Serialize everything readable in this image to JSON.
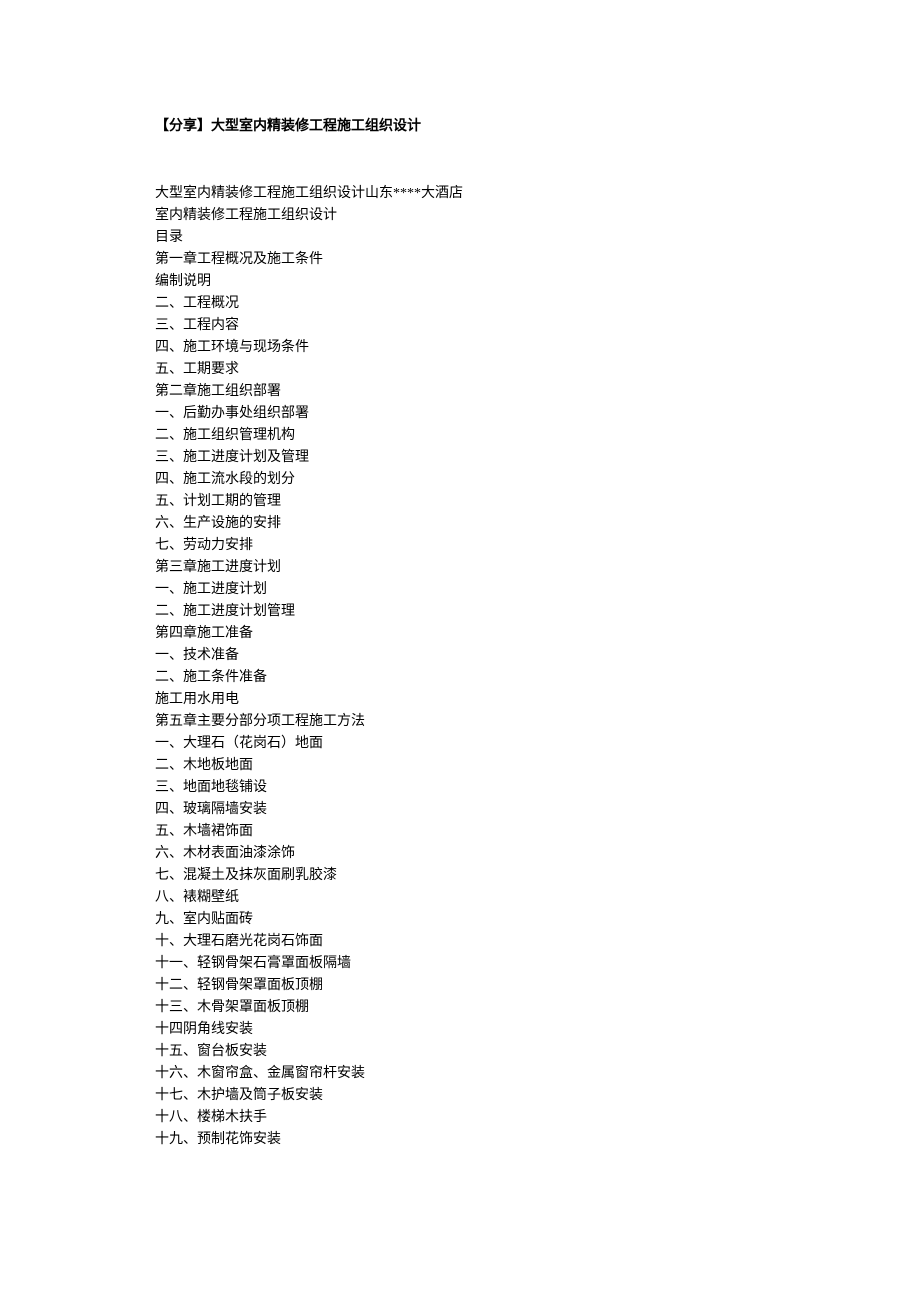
{
  "title": "【分享】大型室内精装修工程施工组织设计",
  "lines": [
    "大型室内精装修工程施工组织设计山东****大酒店",
    "室内精装修工程施工组织设计",
    "目录",
    "第一章工程概况及施工条件",
    "编制说明",
    "二、工程概况",
    "三、工程内容",
    "四、施工环境与现场条件",
    "五、工期要求",
    "第二章施工组织部署",
    "一、后勤办事处组织部署",
    "二、施工组织管理机构",
    "三、施工进度计划及管理",
    "四、施工流水段的划分",
    "五、计划工期的管理",
    "六、生产设施的安排",
    "七、劳动力安排",
    "第三章施工进度计划",
    "一、施工进度计划",
    "二、施工进度计划管理",
    "第四章施工准备",
    "一、技术准备",
    "二、施工条件准备",
    "施工用水用电",
    "第五章主要分部分项工程施工方法",
    "一、大理石（花岗石）地面",
    "二、木地板地面",
    "三、地面地毯铺设",
    "四、玻璃隔墙安装",
    "五、木墙裙饰面",
    "六、木材表面油漆涂饰",
    "七、混凝土及抹灰面刷乳胶漆",
    "八、裱糊壁纸",
    "九、室内贴面砖",
    "十、大理石磨光花岗石饰面",
    "十一、轻钢骨架石膏罩面板隔墙",
    "十二、轻钢骨架罩面板顶棚",
    "十三、木骨架罩面板顶棚",
    "十四阴角线安装",
    "十五、窗台板安装",
    "十六、木窗帘盒、金属窗帘杆安装",
    "十七、木护墙及筒子板安装",
    "十八、楼梯木扶手",
    "十九、预制花饰安装"
  ]
}
